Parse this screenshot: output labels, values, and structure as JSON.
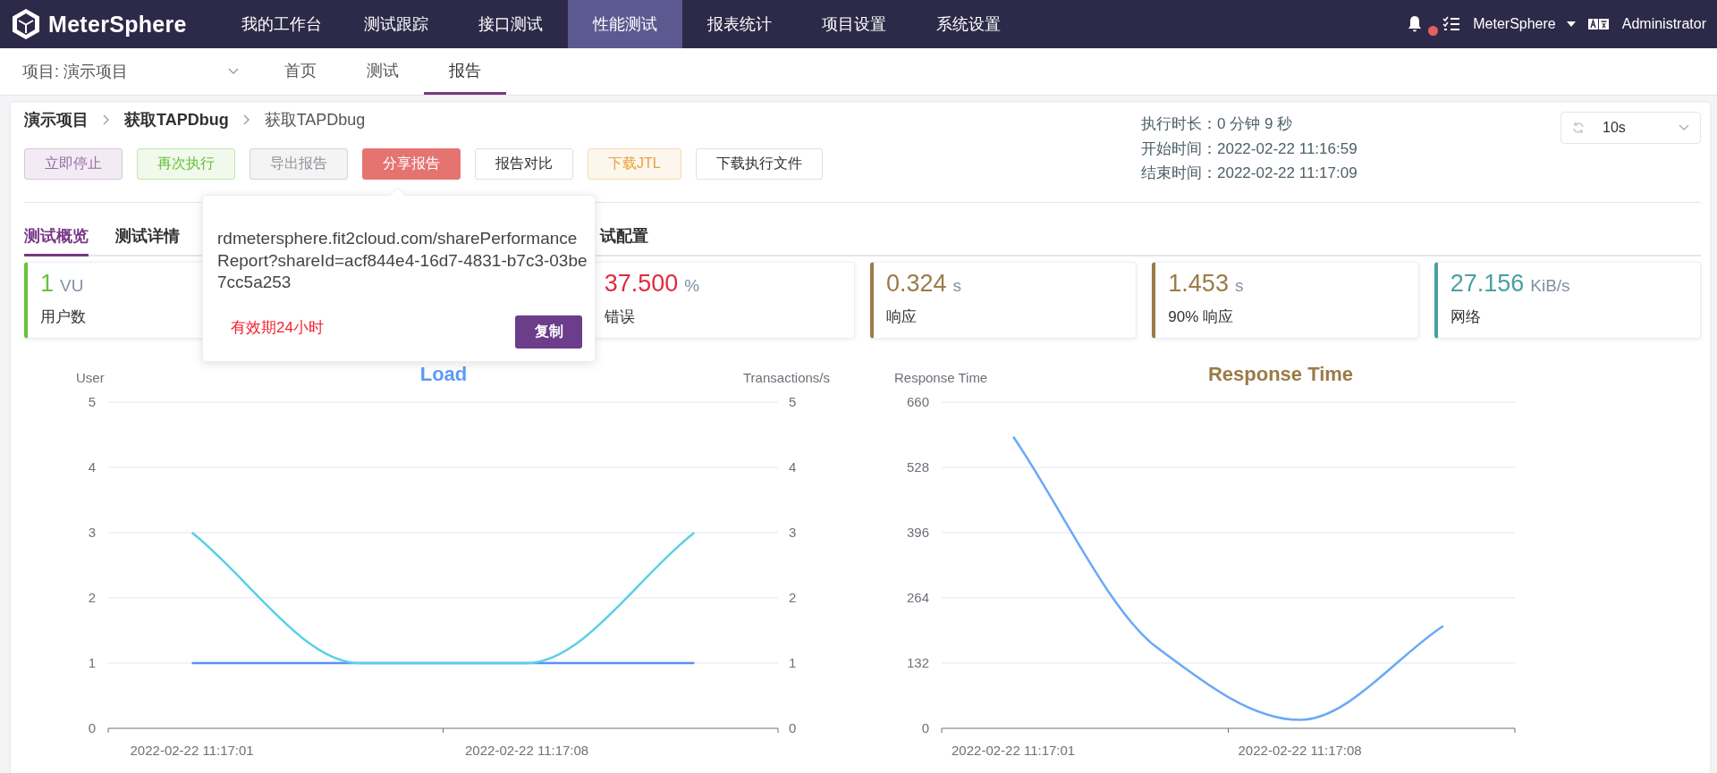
{
  "top_nav": {
    "logo": "MeterSphere",
    "items": [
      {
        "label": "我的工作台",
        "selected": false
      },
      {
        "label": "测试跟踪",
        "selected": false
      },
      {
        "label": "接口测试",
        "selected": false
      },
      {
        "label": "性能测试",
        "selected": true
      },
      {
        "label": "报表统计",
        "selected": false
      },
      {
        "label": "项目设置",
        "selected": false
      },
      {
        "label": "系统设置",
        "selected": false
      }
    ],
    "unread": true,
    "workspace": "MeterSphere",
    "user": "Administrator"
  },
  "sub_nav": {
    "project": "项目: 演示项目",
    "tabs": [
      {
        "label": "首页",
        "selected": false
      },
      {
        "label": "测试",
        "selected": false
      },
      {
        "label": "报告",
        "selected": true
      }
    ]
  },
  "breadcrumb": [
    "演示项目",
    "获取TAPDbug",
    "获取TAPDbug"
  ],
  "actions": [
    {
      "label": "立即停止",
      "kind": "primary"
    },
    {
      "label": "再次执行",
      "kind": "success"
    },
    {
      "label": "导出报告",
      "kind": "info"
    },
    {
      "label": "分享报告",
      "kind": "danger"
    },
    {
      "label": "报告对比",
      "kind": "plain"
    },
    {
      "label": "下载JTL",
      "kind": "warning"
    },
    {
      "label": "下载执行文件",
      "kind": "plain"
    }
  ],
  "run_info": [
    "执行时长：0 分钟 9 秒",
    "开始时间：2022-02-22 11:16:59",
    "结束时间：2022-02-22 11:17:09"
  ],
  "refresh_select": {
    "value": "10s"
  },
  "report_tabs": [
    {
      "label": "测试概览",
      "selected": true
    },
    {
      "label": "测试详情",
      "selected": false
    },
    {
      "label": "试配置",
      "selected": false
    }
  ],
  "share_popover": {
    "url": "rdmetersphere.fit2cloud.com/sharePerformanceReport?shareId=acf844e4-16d7-4831-b7c3-03be7cc5a253",
    "validity": "有效期24小时",
    "copy_button": "复制"
  },
  "metrics": [
    {
      "value": "1",
      "unit": "VU",
      "label": "用户数",
      "color": "#67c23a"
    },
    {
      "value": "37.500",
      "unit": "%",
      "label": "错误",
      "color": "#e02b3c"
    },
    {
      "value": "0.324",
      "unit": "s",
      "label": "响应",
      "color": "#9b7b47"
    },
    {
      "value": "1.453",
      "unit": "s",
      "label": "90% 响应",
      "color": "#9b7b47"
    },
    {
      "value": "27.156",
      "unit": "KiB/s",
      "label": "网络",
      "color": "#4a9fa0"
    }
  ],
  "charts": [
    {
      "chart_data": {
        "type": "line",
        "title": "Load",
        "ylabel": "User",
        "y2label": "Transactions/s",
        "categories": [
          "2022-02-22 11:17:01",
          null,
          "2022-02-22 11:17:08",
          null
        ],
        "grid": true,
        "ylim": [
          0,
          5
        ],
        "yticks": [
          0,
          1,
          2,
          3,
          4,
          5
        ],
        "y2lim": [
          0,
          5
        ],
        "y2ticks": [
          0,
          1,
          2,
          3,
          4,
          5
        ],
        "series": [
          {
            "color": "#5b8ff9",
            "values": [
              1,
              1,
              1,
              1
            ]
          },
          {
            "color": "#5ad0e6",
            "values": [
              3,
              1,
              1,
              3
            ]
          }
        ]
      }
    },
    {
      "chart_data": {
        "type": "line",
        "title": "Response Time",
        "ylabel": "Response Time",
        "categories": [
          "2022-02-22 11:17:01",
          null,
          "2022-02-22 11:17:08",
          null
        ],
        "grid": true,
        "ylim": [
          0,
          660
        ],
        "yticks": [
          0,
          132,
          264,
          396,
          528,
          660
        ],
        "series": [
          {
            "color": "#6aa9f5",
            "values": [
              590,
              164,
              17,
              207
            ]
          }
        ]
      }
    }
  ]
}
